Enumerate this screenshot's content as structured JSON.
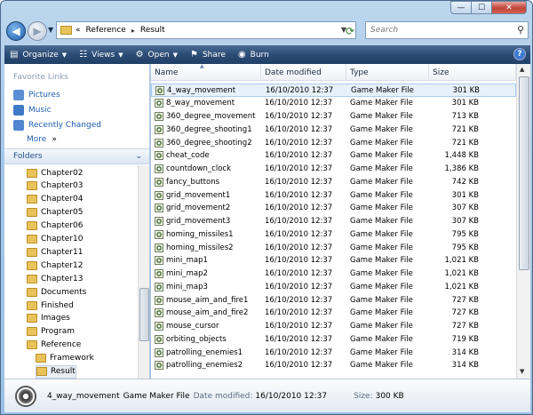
{
  "window": {
    "minimize": "—",
    "maximize": "☐",
    "close": "✕"
  },
  "address": {
    "prefix": "«",
    "path": [
      "Reference",
      "Result"
    ]
  },
  "search": {
    "placeholder": "Search"
  },
  "toolbar": {
    "organize": "Organize",
    "views": "Views",
    "open": "Open",
    "share": "Share",
    "burn": "Burn",
    "help": "?"
  },
  "favorites": {
    "title": "Favorite Links",
    "items": [
      {
        "label": "Pictures",
        "color": "#5a8fd6"
      },
      {
        "label": "Music",
        "color": "#3f7ac8"
      },
      {
        "label": "Recently Changed",
        "color": "#4f86cf"
      },
      {
        "label": "More",
        "color": ""
      }
    ],
    "more_arrow": "»"
  },
  "folders": {
    "title": "Folders",
    "items": [
      "Chapter02",
      "Chapter03",
      "Chapter04",
      "Chapter05",
      "Chapter06",
      "Chapter10",
      "Chapter11",
      "Chapter12",
      "Chapter13",
      "Documents",
      "Finished",
      "Images",
      "Program",
      "Reference",
      "Framework",
      "Result"
    ],
    "selected": "Result"
  },
  "columns": {
    "name": "Name",
    "date": "Date modified",
    "type": "Type",
    "size": "Size"
  },
  "files": [
    {
      "name": "4_way_movement",
      "date": "16/10/2010 12:37",
      "type": "Game Maker File",
      "size": "301 KB"
    },
    {
      "name": "8_way_movement",
      "date": "16/10/2010 12:37",
      "type": "Game Maker File",
      "size": "301 KB"
    },
    {
      "name": "360_degree_movement",
      "date": "16/10/2010 12:37",
      "type": "Game Maker File",
      "size": "713 KB"
    },
    {
      "name": "360_degree_shooting1",
      "date": "16/10/2010 12:37",
      "type": "Game Maker File",
      "size": "721 KB"
    },
    {
      "name": "360_degree_shooting2",
      "date": "16/10/2010 12:37",
      "type": "Game Maker File",
      "size": "721 KB"
    },
    {
      "name": "cheat_code",
      "date": "16/10/2010 12:37",
      "type": "Game Maker File",
      "size": "1,448 KB"
    },
    {
      "name": "countdown_clock",
      "date": "16/10/2010 12:37",
      "type": "Game Maker File",
      "size": "1,386 KB"
    },
    {
      "name": "fancy_buttons",
      "date": "16/10/2010 12:37",
      "type": "Game Maker File",
      "size": "742 KB"
    },
    {
      "name": "grid_movement1",
      "date": "16/10/2010 12:37",
      "type": "Game Maker File",
      "size": "301 KB"
    },
    {
      "name": "grid_movement2",
      "date": "16/10/2010 12:37",
      "type": "Game Maker File",
      "size": "307 KB"
    },
    {
      "name": "grid_movement3",
      "date": "16/10/2010 12:37",
      "type": "Game Maker File",
      "size": "307 KB"
    },
    {
      "name": "homing_missiles1",
      "date": "16/10/2010 12:37",
      "type": "Game Maker File",
      "size": "795 KB"
    },
    {
      "name": "homing_missiles2",
      "date": "16/10/2010 12:37",
      "type": "Game Maker File",
      "size": "795 KB"
    },
    {
      "name": "mini_map1",
      "date": "16/10/2010 12:37",
      "type": "Game Maker File",
      "size": "1,021 KB"
    },
    {
      "name": "mini_map2",
      "date": "16/10/2010 12:37",
      "type": "Game Maker File",
      "size": "1,021 KB"
    },
    {
      "name": "mini_map3",
      "date": "16/10/2010 12:37",
      "type": "Game Maker File",
      "size": "1,021 KB"
    },
    {
      "name": "mouse_aim_and_fire1",
      "date": "16/10/2010 12:37",
      "type": "Game Maker File",
      "size": "727 KB"
    },
    {
      "name": "mouse_aim_and_fire2",
      "date": "16/10/2010 12:37",
      "type": "Game Maker File",
      "size": "727 KB"
    },
    {
      "name": "mouse_cursor",
      "date": "16/10/2010 12:37",
      "type": "Game Maker File",
      "size": "727 KB"
    },
    {
      "name": "orbiting_objects",
      "date": "16/10/2010 12:37",
      "type": "Game Maker File",
      "size": "719 KB"
    },
    {
      "name": "patrolling_enemies1",
      "date": "16/10/2010 12:37",
      "type": "Game Maker File",
      "size": "314 KB"
    },
    {
      "name": "patrolling_enemies2",
      "date": "16/10/2010 12:37",
      "type": "Game Maker File",
      "size": "314 KB"
    }
  ],
  "selected_file": "4_way_movement",
  "details": {
    "name": "4_way_movement",
    "type": "Game Maker File",
    "date_label": "Date modified:",
    "date": "16/10/2010 12:37",
    "size_label": "Size:",
    "size": "300 KB"
  }
}
